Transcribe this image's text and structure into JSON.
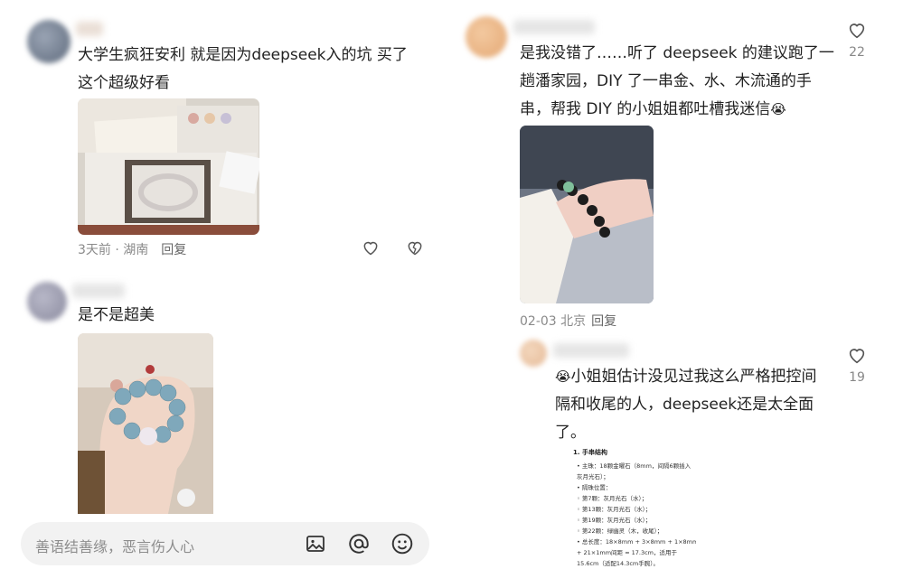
{
  "left": {
    "comment1": {
      "text_line1": "大学生疯狂安利 就是因为deepseek入的坑 买了",
      "text_line2": "这个超级好看",
      "photo_icon": "bracelet-gift-box-photo",
      "meta_time": "3天前 · 湖南",
      "reply_label": "回复"
    },
    "comment2": {
      "text": "是不是超美",
      "photo_icon": "blue-bracelet-hand-photo"
    }
  },
  "right": {
    "comment1": {
      "text_line1": "是我没错了……听了 deepseek 的建议跑了一",
      "text_line2": "趟潘家园，DIY 了一串金、水、木流通的手",
      "text_line3": "串，帮我 DIY 的小姐姐都吐槽我迷信",
      "emoji": "😭",
      "photo_icon": "black-bracelet-wrist-photo",
      "meta_time": "02-03 北京",
      "reply_label": "回复",
      "like_count": "22"
    },
    "comment2": {
      "emoji": "😭",
      "text_line1": "小姐姐估计没见过我这么严格把控间",
      "text_line2": "隔和收尾的人，deepseek还是太全面",
      "text_line3": "了。",
      "like_count": "19",
      "doc": {
        "title": "1. 手串结构",
        "lines": [
          "• 主珠：18颗金曜石（8mm，间隔6颗插入",
          "   灰月光石）；",
          "• 隔珠位置：",
          "   ◦ 第7颗：灰月光石（水）；",
          "   ◦ 第13颗：灰月光石（水）；",
          "   ◦ 第19颗：灰月光石（水）；",
          "   ◦ 第22颗：绿幽灵（木，收尾）；",
          "• 总长度：18×8mm + 3×8mm + 1×8mm",
          "   + 21×1mm间距 ≈ 17.3cm，适用于",
          "   15.6cm（适配14.3cm手腕）。"
        ]
      }
    }
  },
  "input": {
    "placeholder": "善语结善缘，恶言伤人心",
    "icons": [
      "image-icon",
      "at-icon",
      "emoji-icon"
    ]
  },
  "colors": {
    "text": "#222222",
    "meta": "#8a8a8a",
    "input_bg": "#f2f2f2"
  }
}
